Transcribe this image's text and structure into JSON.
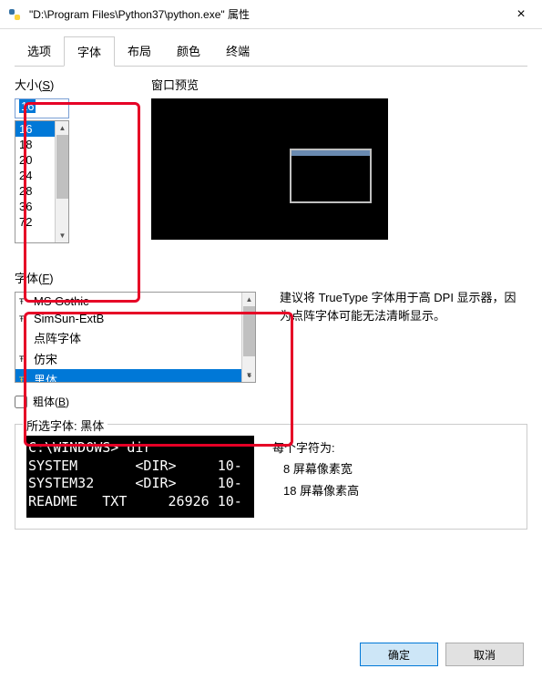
{
  "titlebar": {
    "title": "\"D:\\Program Files\\Python37\\python.exe\" 属性",
    "close": "×"
  },
  "tabs": [
    {
      "label": "选项"
    },
    {
      "label": "字体"
    },
    {
      "label": "布局"
    },
    {
      "label": "颜色"
    },
    {
      "label": "终端"
    }
  ],
  "size": {
    "label_pre": "大小(",
    "label_u": "S",
    "label_post": ")",
    "input_value": "16",
    "items": [
      "16",
      "18",
      "20",
      "24",
      "28",
      "36",
      "72"
    ],
    "selected_index": 0
  },
  "preview": {
    "label": "窗口预览"
  },
  "font": {
    "label_pre": "字体(",
    "label_u": "F",
    "label_post": ")",
    "items": [
      {
        "name": "MS Gothic",
        "tt": true
      },
      {
        "name": "SimSun-ExtB",
        "tt": true
      },
      {
        "name": "点阵字体",
        "tt": false
      },
      {
        "name": "仿宋",
        "tt": true
      },
      {
        "name": "黑体",
        "tt": true
      }
    ],
    "selected_index": 4,
    "hint": "建议将 TrueType 字体用于高 DPI 显示器，因为点阵字体可能无法清晰显示。"
  },
  "bold": {
    "label_pre": "粗体(",
    "label_u": "B",
    "label_post": ")"
  },
  "selected": {
    "legend_pre": "所选字体: ",
    "legend_font": "黑体",
    "sample": "C:\\WINDOWS> dir\nSYSTEM       <DIR>     10-\nSYSTEM32     <DIR>     10-\nREADME   TXT     26926 10-",
    "char_label": "每个字符为:",
    "char_w": "8 屏幕像素宽",
    "char_h": "18 屏幕像素高"
  },
  "buttons": {
    "ok": "确定",
    "cancel": "取消"
  }
}
